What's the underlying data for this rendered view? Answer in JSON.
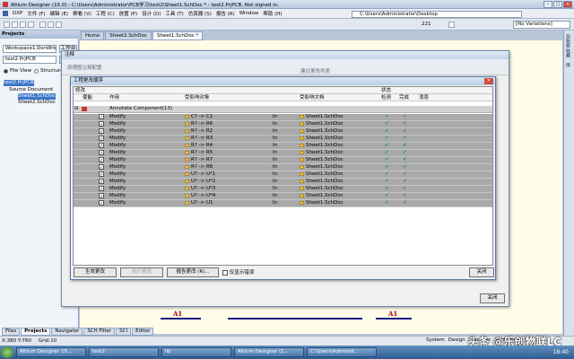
{
  "window": {
    "title": "Altium Designer (15.0) - C:\\Users\\Administrator\\PCB学习\\test2\\Sheet1.SchDoc * - test2.PrjPCB. Not signed in."
  },
  "menu": [
    "DXP",
    "文件 (F)",
    "编辑 (E)",
    "察看 (V)",
    "工程 (C)",
    "放置 (P)",
    "设计 (D)",
    "工具 (T)",
    "仿真器 (S)",
    "报告 (R)",
    "Window",
    "帮助 (H)"
  ],
  "address_bar": "C:\\Users\\Administrator\\Desktop",
  "toolbar": {
    "zoom": "221",
    "variant": "[No Variations]"
  },
  "projects_panel": {
    "title": "Projects",
    "workspace": "Workspace1.DsnWrk",
    "workspace_btn": "工作台",
    "project": "test2.PrjPCB",
    "project_btn": "工程",
    "view_file": "File View",
    "view_structure": "Structure E",
    "tree": [
      "test2.PrjPCB",
      "Source Document",
      "Sheet1.SchDoc",
      "Sheet2.SchDoc"
    ]
  },
  "doc_tabs": [
    "Home",
    "Sheet2.SchDoc",
    "Sheet1.SchDoc *"
  ],
  "right_panels": [
    "剪贴板",
    "收藏",
    "库"
  ],
  "schematic": {
    "net_labels": [
      "A1",
      "A1"
    ]
  },
  "bottom_tabs": [
    "Files",
    "Projects",
    "Navigator",
    "SCH Filter",
    "SCI",
    "Editor"
  ],
  "status": {
    "coords": "X:380 Y:760",
    "grid": "Grid:10",
    "right": [
      "System",
      "Design",
      "Compiler",
      "SCH",
      "Instruments"
    ]
  },
  "outer_dialog": {
    "title": "注释",
    "header_left": "原理图注释配置",
    "header_mid": "建议更改列表",
    "ok": "关闭"
  },
  "eco_dialog": {
    "title": "工程更改顺序",
    "group_headers": {
      "changes": "修改",
      "status": "状态"
    },
    "headers": {
      "enable": "使能",
      "action": "作用",
      "affected": "受影响对象",
      "doc": "受影响文档",
      "check": "检测",
      "done": "完成",
      "msg": "消息"
    },
    "group_row": "Annotate Component(13)",
    "rows": [
      {
        "action": "Modify",
        "affected": "C? -> C1",
        "in": "In",
        "doc": "Sheet1.SchDoc"
      },
      {
        "action": "Modify",
        "affected": "R? -> R6",
        "in": "In",
        "doc": "Sheet1.SchDoc"
      },
      {
        "action": "Modify",
        "affected": "R? -> R2",
        "in": "In",
        "doc": "Sheet1.SchDoc"
      },
      {
        "action": "Modify",
        "affected": "R? -> R3",
        "in": "In",
        "doc": "Sheet1.SchDoc"
      },
      {
        "action": "Modify",
        "affected": "R? -> R4",
        "in": "In",
        "doc": "Sheet1.SchDoc"
      },
      {
        "action": "Modify",
        "affected": "R? -> R5",
        "in": "In",
        "doc": "Sheet1.SchDoc"
      },
      {
        "action": "Modify",
        "affected": "R? -> R7",
        "in": "In",
        "doc": "Sheet1.SchDoc"
      },
      {
        "action": "Modify",
        "affected": "R? -> R8",
        "in": "In",
        "doc": "Sheet1.SchDoc"
      },
      {
        "action": "Modify",
        "affected": "U? -> U*1",
        "in": "In",
        "doc": "Sheet1.SchDoc"
      },
      {
        "action": "Modify",
        "affected": "U? -> U*2",
        "in": "In",
        "doc": "Sheet1.SchDoc"
      },
      {
        "action": "Modify",
        "affected": "U? -> U*3",
        "in": "In",
        "doc": "Sheet1.SchDoc"
      },
      {
        "action": "Modify",
        "affected": "U? -> U*4",
        "in": "In",
        "doc": "Sheet1.SchDoc"
      },
      {
        "action": "Modify",
        "affected": "U? -> U1",
        "in": "In",
        "doc": "Sheet1.SchDoc"
      }
    ],
    "buttons": {
      "validate": "生效更改",
      "execute": "执行更改",
      "report": "报告更改 (R)...",
      "only_errors": "仅显示错误",
      "close": "关闭"
    }
  },
  "taskbar": [
    "Altium Designer 15...",
    "test2",
    "lib",
    "Altium Designer (1...",
    "C:\\Users\\Administ..."
  ],
  "clock": "18:40",
  "watermark": "头条 @乐创物联LC"
}
